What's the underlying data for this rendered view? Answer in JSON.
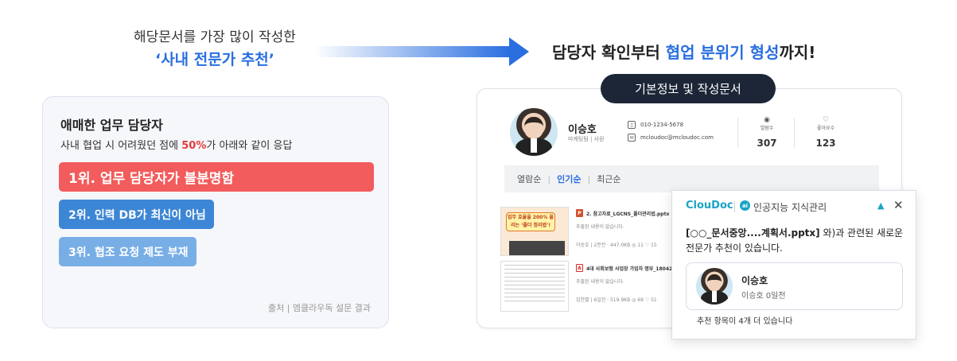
{
  "left": {
    "heading_line1": "해당문서를 가장 많이 작성한",
    "heading_line2": "‘사내 전문가 추천’",
    "card": {
      "title": "애매한 업무 담당자",
      "subtitle_pre": "사내 협업 시 어려웠던 점에 ",
      "subtitle_highlight": "50%",
      "subtitle_post": "가 아래와 같이 응답",
      "ranks": [
        "1위. 업무 담당자가 불분명함",
        "2위. 인력 DB가 최신이 아님",
        "3위. 협조 요청 제도 부재"
      ],
      "source": "출처 |  엠클라우독 설문 결과"
    }
  },
  "right": {
    "headline_pre": "담당자 확인부터 ",
    "headline_blue": "협업 분위기 형성",
    "headline_post": "까지!",
    "pill": "기본정보 및 작성문서",
    "profile": {
      "name": "이승호",
      "dept": "마케팅팀  |  사원",
      "phone": "010-1234-5678",
      "email": "mcloudoc@mcloudoc.com",
      "stats": [
        {
          "label": "열람수",
          "value": "307",
          "icon": "eye-icon"
        },
        {
          "label": "좋아요수",
          "value": "123",
          "icon": "heart-icon"
        }
      ]
    },
    "tabs": [
      "열람순",
      "인기순",
      "최근순"
    ],
    "active_tab": "인기순",
    "docs": [
      {
        "title": "2. 참고자료_LGCNS_폴더관리법.pptx",
        "desc": "추출된 내용이 없습니다.",
        "meta": "이승호  |  2분전 · 447.0KB    ◎ 11   ♡ 15",
        "type": "pptx",
        "thumb_text": "업무 효율을 200% 올리는 ‘폴더 정리법’!"
      },
      {
        "title": "4대 사회보험 사업장 가입자 명부_180427",
        "desc": "추출된 내용이 없습니다.",
        "meta": "임찬별  |  6일전 · 519.9KB    ◎ 69   ♡ 51",
        "type": "pdf"
      }
    ],
    "popup": {
      "logo": "ClouDoc",
      "ai_badge": "ai",
      "brand": "인공지능 지식관리",
      "doc_ref": "[○○_문서중앙....계획서.pptx]",
      "message_post": "와)과 관련된 새로운 전문가 추천이 있습니다.",
      "rec_name": "이승호",
      "rec_meta": "이승호  0일전",
      "more": "추천 항목이 4개 더 있습니다"
    }
  },
  "colors": {
    "accent_blue": "#2a6fe0",
    "rank1": "#f25c5c",
    "rank2": "#3d86d6",
    "rank3": "#78aee6",
    "pill_bg": "#1d2637",
    "cloudoc": "#1aa3c7"
  }
}
